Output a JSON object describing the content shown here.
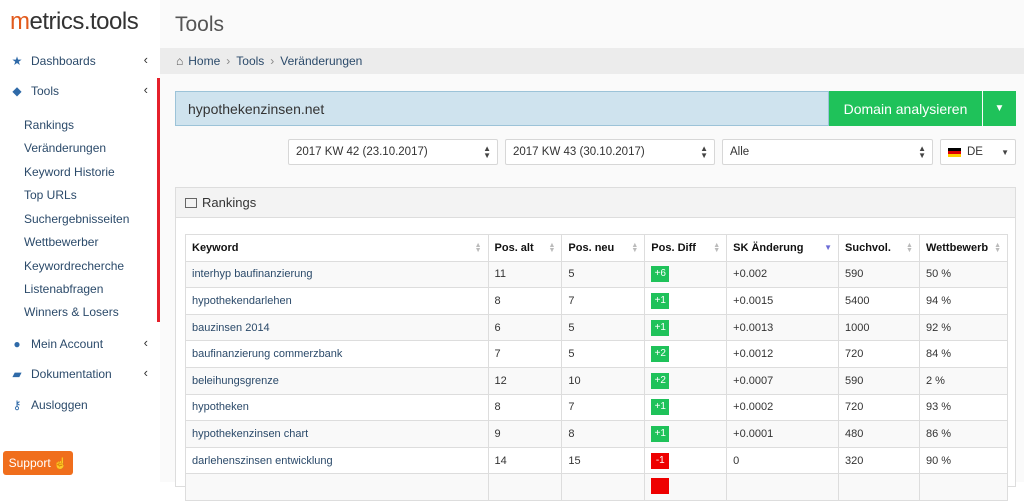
{
  "brand": {
    "logo_first": "m",
    "logo_rest": "etrics.tools"
  },
  "sidebar": {
    "items": [
      {
        "label": "Dashboards",
        "icon": "star-icon"
      },
      {
        "label": "Tools",
        "icon": "cube-icon"
      },
      {
        "label": "Mein Account",
        "icon": "user-icon"
      },
      {
        "label": "Dokumentation",
        "icon": "folder-open-icon"
      },
      {
        "label": "Ausloggen",
        "icon": "key-icon"
      }
    ],
    "tools_sub": [
      "Rankings",
      "Veränderungen",
      "Keyword Historie",
      "Top URLs",
      "Suchergebnisseiten",
      "Wettbewerber",
      "Keywordrecherche",
      "Listenabfragen",
      "Winners & Losers"
    ],
    "support_label": "Support"
  },
  "header": {
    "title": "Tools"
  },
  "breadcrumb": [
    "Home",
    "Tools",
    "Veränderungen"
  ],
  "domain": {
    "value": "hypothekenzinsen.net",
    "button_label": "Domain analysieren"
  },
  "filters": {
    "week_old": "2017 KW 42 (23.10.2017)",
    "week_new": "2017 KW 43 (30.10.2017)",
    "filter": "Alle",
    "country": "DE"
  },
  "panel": {
    "title": "Rankings"
  },
  "table": {
    "headers": [
      "Keyword",
      "Pos. alt",
      "Pos. neu",
      "Pos. Diff",
      "SK Änderung",
      "Suchvol.",
      "Wettbewerb"
    ],
    "rows": [
      {
        "keyword": "interhyp baufinanzierung",
        "pos_alt": "11",
        "pos_neu": "5",
        "diff": "+6",
        "sk": "+0.002",
        "vol": "590",
        "wb": "50 %"
      },
      {
        "keyword": "hypothekendarlehen",
        "pos_alt": "8",
        "pos_neu": "7",
        "diff": "+1",
        "sk": "+0.0015",
        "vol": "5400",
        "wb": "94 %"
      },
      {
        "keyword": "bauzinsen 2014",
        "pos_alt": "6",
        "pos_neu": "5",
        "diff": "+1",
        "sk": "+0.0013",
        "vol": "1000",
        "wb": "92 %"
      },
      {
        "keyword": "baufinanzierung commerzbank",
        "pos_alt": "7",
        "pos_neu": "5",
        "diff": "+2",
        "sk": "+0.0012",
        "vol": "720",
        "wb": "84 %"
      },
      {
        "keyword": "beleihungsgrenze",
        "pos_alt": "12",
        "pos_neu": "10",
        "diff": "+2",
        "sk": "+0.0007",
        "vol": "590",
        "wb": "2 %"
      },
      {
        "keyword": "hypotheken",
        "pos_alt": "8",
        "pos_neu": "7",
        "diff": "+1",
        "sk": "+0.0002",
        "vol": "720",
        "wb": "93 %"
      },
      {
        "keyword": "hypothekenzinsen chart",
        "pos_alt": "9",
        "pos_neu": "8",
        "diff": "+1",
        "sk": "+0.0001",
        "vol": "480",
        "wb": "86 %"
      },
      {
        "keyword": "darlehenszinsen entwicklung",
        "pos_alt": "14",
        "pos_neu": "15",
        "diff": "-1",
        "sk": "0",
        "vol": "320",
        "wb": "90 %"
      },
      {
        "keyword": "",
        "pos_alt": "",
        "pos_neu": "",
        "diff": "",
        "sk": "",
        "vol": "",
        "wb": ""
      }
    ]
  },
  "colors": {
    "accent_green": "#1fc25a",
    "diff_negative": "#ee0000",
    "support_orange": "#f06e1c",
    "active_bar": "#e5202b"
  }
}
